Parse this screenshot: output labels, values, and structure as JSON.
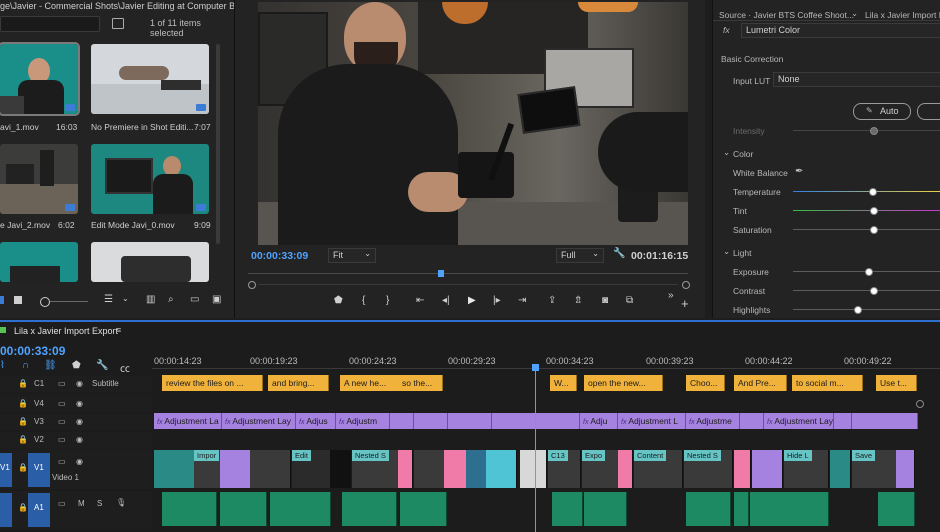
{
  "project": {
    "path": "ge\\Javier - Commercial Shots\\Javier Editing at Computer B Roll",
    "selected_count": "1 of 11 items selected",
    "items": [
      {
        "name": "avi_1.mov",
        "duration": "16:03"
      },
      {
        "name": "No Premiere in Shot Editi...",
        "duration": "7:07"
      },
      {
        "name": "e Javi_2.mov",
        "duration": "6:02"
      },
      {
        "name": "Edit Mode Javi_0.mov",
        "duration": "9:09"
      }
    ]
  },
  "program": {
    "timecode": "00:00:33:09",
    "fit": "Fit",
    "quality": "Full",
    "duration": "00:01:16:15"
  },
  "lumetri": {
    "source": "Source · Javier BTS Coffee Shoot...",
    "sequence": "Lila x Javier Import E...",
    "effect": "Lumetri Color",
    "section_basic": "Basic Correction",
    "input_lut_label": "Input LUT",
    "input_lut_value": "None",
    "auto": "Auto",
    "intensity": "Intensity",
    "color": "Color",
    "white_balance": "White Balance",
    "temperature": "Temperature",
    "tint": "Tint",
    "saturation": "Saturation",
    "light": "Light",
    "exposure": "Exposure",
    "contrast": "Contrast",
    "highlights": "Highlights"
  },
  "timeline": {
    "sequence_name": "Lila x Javier Import Export",
    "timecode": "00:00:33:09",
    "ruler": [
      "00:00:14:23",
      "00:00:19:23",
      "00:00:24:23",
      "00:00:29:23",
      "00:00:34:23",
      "00:00:39:23",
      "00:00:44:22",
      "00:00:49:22"
    ],
    "tracks": {
      "c1": "C1",
      "subtitle": "Subtitle",
      "v4": "V4",
      "v3": "V3",
      "v2": "V2",
      "v1": "V1",
      "video1": "Video 1",
      "a1": "A1",
      "m": "M",
      "s": "S"
    },
    "subtitles": [
      "review the files on ...",
      "and bring...",
      "A new he...",
      "so the...",
      "W...",
      "open the new...",
      "Choo...",
      "And Pre...",
      "to social m...",
      "Use t..."
    ],
    "adjustments": [
      "Adjustment La",
      "Adjustment Lay",
      "Adjus",
      "Adjustm",
      "Adju",
      "Adjustment L",
      "Adjustme",
      "Adjustment Layer"
    ],
    "video_labels": [
      "Impor",
      "Edit",
      "Nested S",
      "C13",
      "Expo",
      "Content",
      "Nested S",
      "Hide L",
      "Save"
    ]
  },
  "colors": {
    "accent": "#2f6fcf",
    "timecode": "#4fa3ff",
    "subtitle": "#f1b23b",
    "adjustment": "#a682e0",
    "audio": "#1e8a63",
    "video_label": "#66c4c4"
  }
}
